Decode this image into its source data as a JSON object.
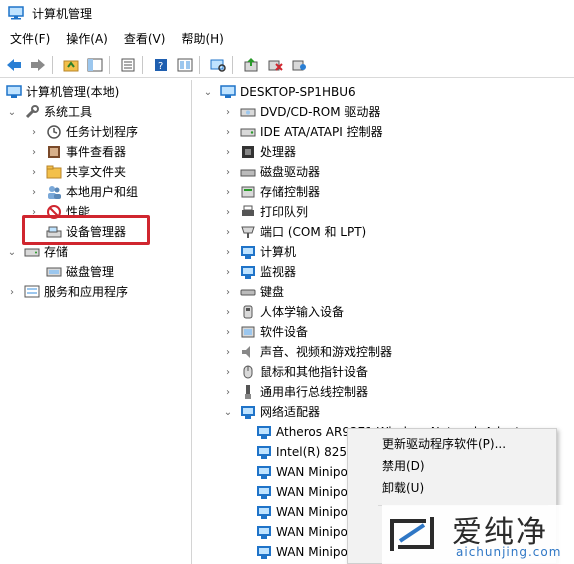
{
  "window": {
    "title": "计算机管理"
  },
  "menu": [
    {
      "label": "文件(F)"
    },
    {
      "label": "操作(A)"
    },
    {
      "label": "查看(V)"
    },
    {
      "label": "帮助(H)"
    }
  ],
  "tree_left": [
    {
      "label": "计算机管理(本地)",
      "icon": "computer-management-icon"
    },
    {
      "label": "系统工具",
      "icon": "tools-icon"
    },
    {
      "label": "任务计划程序",
      "icon": "clock-icon"
    },
    {
      "label": "事件查看器",
      "icon": "event-viewer-icon"
    },
    {
      "label": "共享文件夹",
      "icon": "shared-folder-icon"
    },
    {
      "label": "本地用户和组",
      "icon": "users-icon"
    },
    {
      "label": "性能",
      "icon": "performance-icon"
    },
    {
      "label": "设备管理器",
      "icon": "device-manager-icon"
    },
    {
      "label": "存储",
      "icon": "storage-icon"
    },
    {
      "label": "磁盘管理",
      "icon": "disk-management-icon"
    },
    {
      "label": "服务和应用程序",
      "icon": "services-icon"
    }
  ],
  "tree_right": {
    "root": "DESKTOP-SP1HBU6",
    "items": [
      "DVD/CD-ROM 驱动器",
      "IDE ATA/ATAPI 控制器",
      "处理器",
      "磁盘驱动器",
      "存储控制器",
      "打印队列",
      "端口 (COM 和 LPT)",
      "计算机",
      "监视器",
      "键盘",
      "人体学输入设备",
      "软件设备",
      "声音、视频和游戏控制器",
      "鼠标和其他指针设备",
      "通用串行总线控制器",
      "网络适配器"
    ],
    "network_children": [
      "Atheros AR9271 Wireless Network Adapter",
      "Intel(R) 8256",
      "WAN Minipo",
      "WAN Minipo",
      "WAN Minipo",
      "WAN Minipo",
      "WAN Minipo"
    ]
  },
  "context_menu": [
    "更新驱动程序软件(P)...",
    "禁用(D)",
    "卸载(U)"
  ],
  "watermark": {
    "cn": "爱纯净",
    "en": "aichunjing.com"
  }
}
